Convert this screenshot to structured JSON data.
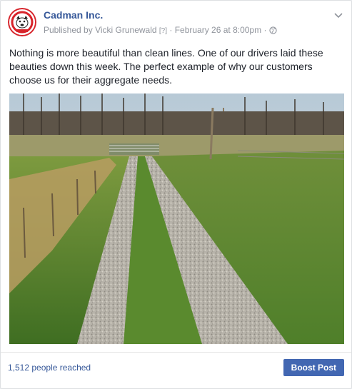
{
  "post": {
    "page_name": "Cadman Inc.",
    "published_by_label": "Published by",
    "author": "Vicki Grunewald",
    "help_marker": "[?]",
    "separator": "·",
    "timestamp": "February 26 at 8:00pm",
    "audience_icon": "globe-icon",
    "options_icon": "chevron-down-icon",
    "text": "Nothing is more beautiful than clean lines. One of our drivers laid these beauties down this week. The perfect example of why our customers choose us for their aggregate needs.",
    "photo_icon": "photo-gravel-driveway"
  },
  "footer": {
    "reach_text": "1,512 people reached",
    "boost_label": "Boost Post"
  },
  "colors": {
    "link_blue": "#365899",
    "button_blue": "#4267b2",
    "meta_gray": "#90949c",
    "brand_red": "#d8232a"
  }
}
